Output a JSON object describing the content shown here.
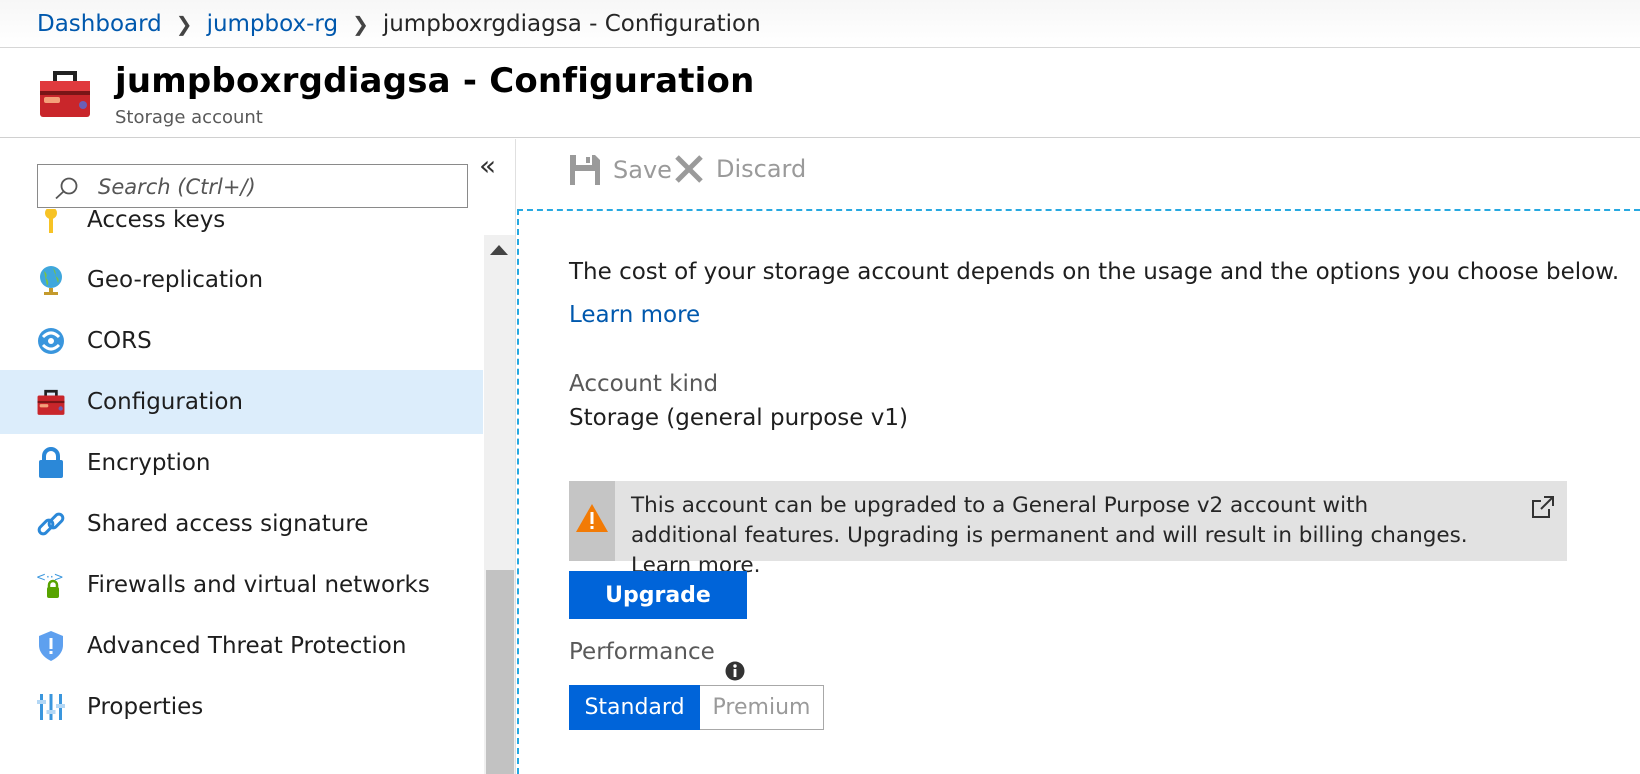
{
  "breadcrumb": {
    "items": [
      "Dashboard",
      "jumpbox-rg"
    ],
    "current": "jumpboxrgdiagsa - Configuration"
  },
  "header": {
    "title": "jumpboxrgdiagsa - Configuration",
    "subtitle": "Storage account",
    "icon": "toolbox-icon"
  },
  "sidebar": {
    "search_placeholder": "Search (Ctrl+/)",
    "collapse_label": "«",
    "items": [
      {
        "label": "Access keys",
        "icon": "key-icon"
      },
      {
        "label": "Geo-replication",
        "icon": "globe-icon"
      },
      {
        "label": "CORS",
        "icon": "cors-icon"
      },
      {
        "label": "Configuration",
        "icon": "toolbox-icon",
        "active": true
      },
      {
        "label": "Encryption",
        "icon": "lock-icon"
      },
      {
        "label": "Shared access signature",
        "icon": "link-icon"
      },
      {
        "label": "Firewalls and virtual networks",
        "icon": "firewall-icon"
      },
      {
        "label": "Advanced Threat Protection",
        "icon": "shield-icon"
      },
      {
        "label": "Properties",
        "icon": "properties-icon"
      }
    ]
  },
  "toolbar": {
    "save_label": "Save",
    "discard_label": "Discard"
  },
  "main": {
    "description": "The cost of your storage account depends on the usage and the options you choose below.",
    "learn_more": "Learn more",
    "account_kind_label": "Account kind",
    "account_kind_value": "Storage (general purpose v1)",
    "notice_text": "This account can be upgraded to a General Purpose v2 account with additional features. Upgrading is permanent and will result in billing changes. Learn more.",
    "upgrade_label": "Upgrade",
    "performance_label": "Performance",
    "performance_options": [
      "Standard",
      "Premium"
    ],
    "performance_selected": "Standard"
  },
  "colors": {
    "accent": "#0064d9",
    "link": "#0058ad",
    "active_nav": "#dcedfb",
    "warning": "#f27b06"
  }
}
